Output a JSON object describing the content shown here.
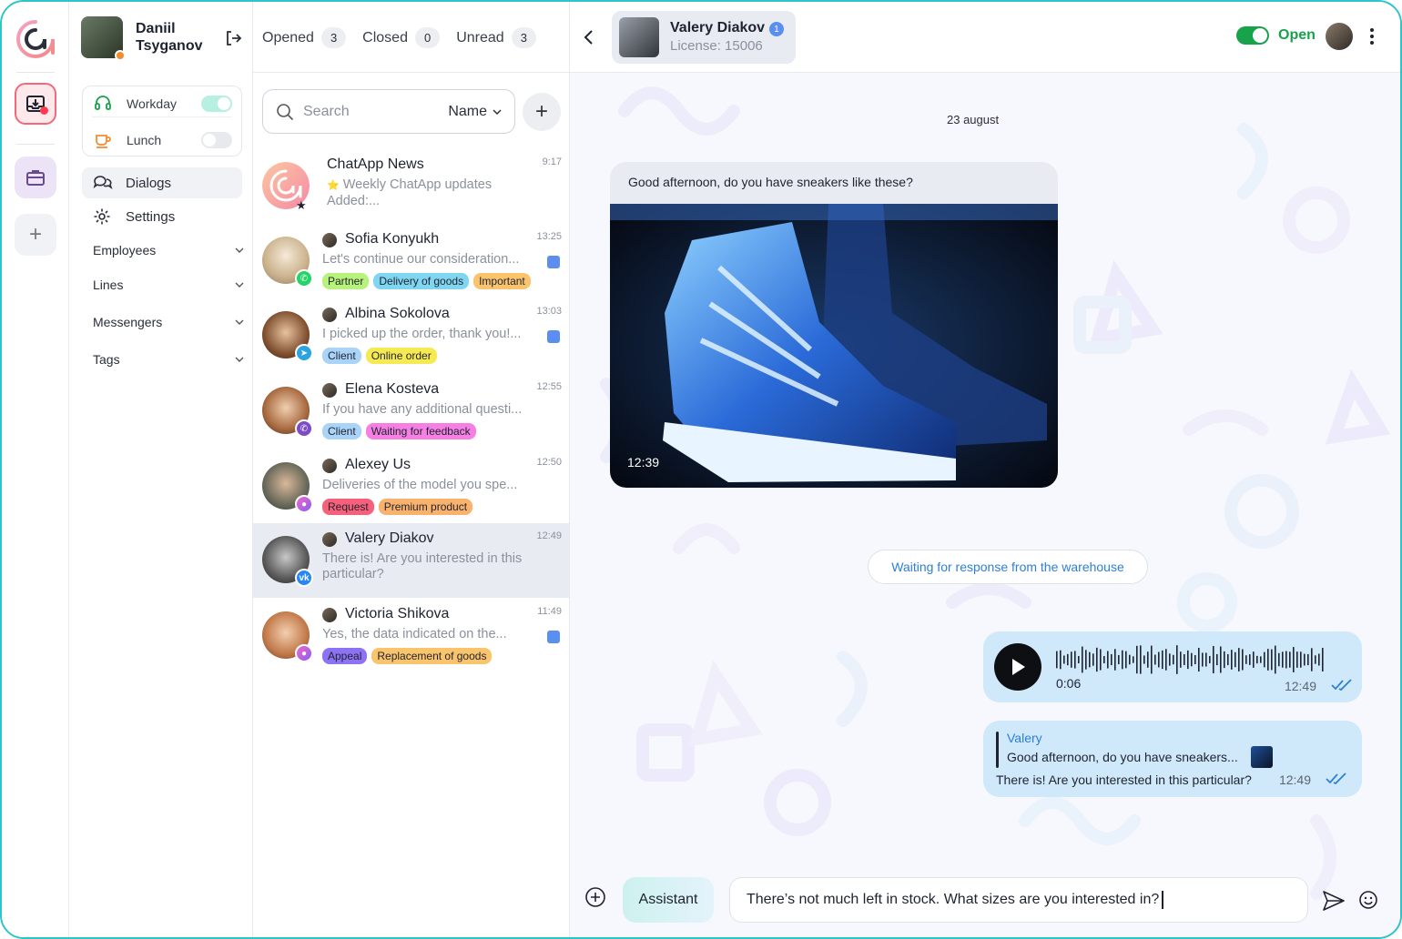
{
  "user": {
    "name": "Daniil Tsyganov"
  },
  "status": {
    "workday_label": "Workday",
    "lunch_label": "Lunch"
  },
  "nav": {
    "dialogs": "Dialogs",
    "settings": "Settings",
    "employees": "Employees",
    "lines": "Lines",
    "messengers": "Messengers",
    "tags": "Tags"
  },
  "tabs": [
    {
      "label": "Opened",
      "count": "3"
    },
    {
      "label": "Closed",
      "count": "0"
    },
    {
      "label": "Unread",
      "count": "3"
    }
  ],
  "search": {
    "placeholder": "Search",
    "sort": "Name"
  },
  "dialogs": [
    {
      "name": "ChatApp News",
      "time": "9:17",
      "preview": "Weekly ChatApp updates Added:...",
      "preview_icon": "⭐"
    },
    {
      "name": "Sofia Konyukh",
      "time": "13:25",
      "preview": "Let's continue our consideration...",
      "tags": [
        "Partner",
        "Delivery of goods",
        "Important"
      ]
    },
    {
      "name": "Albina Sokolova",
      "time": "13:03",
      "preview": "I picked up the order, thank you!...",
      "tags": [
        "Client",
        "Online order"
      ]
    },
    {
      "name": "Elena Kosteva",
      "time": "12:55",
      "preview": "If you have any additional questi...",
      "tags": [
        "Client",
        "Waiting for feedback"
      ]
    },
    {
      "name": "Alexey Us",
      "time": "12:50",
      "preview": "Deliveries of the model you spe...",
      "tags": [
        "Request",
        "Premium product"
      ]
    },
    {
      "name": "Valery Diakov",
      "time": "12:49",
      "preview": "There is! Are you interested in this  particular?"
    },
    {
      "name": "Victoria Shikova",
      "time": "11:49",
      "preview": "Yes, the data indicated on the...",
      "tags": [
        "Appeal",
        "Replacement of goods"
      ]
    }
  ],
  "tag_colors": {
    "Partner": "#b7f27a",
    "Delivery of goods": "#7fd6f0",
    "Important": "#f9c46b",
    "Client": "#a9d4f8",
    "Online order": "#f6ea52",
    "Waiting for feedback": "#f57fe3",
    "Request": "#f7607a",
    "Premium product": "#f9b26b",
    "Appeal": "#8d73f3",
    "Replacement of goods": "#f9c46b"
  },
  "chat": {
    "contact_name": "Valery Diakov",
    "contact_badge": "1",
    "license": "License: 15006",
    "status": "Open",
    "date": "23 august",
    "incoming_text": "Good afternoon, do you have sneakers like these?",
    "incoming_time": "12:39",
    "status_chip": "Waiting for response from the warehouse",
    "voice_duration": "0:06",
    "voice_time": "12:49",
    "reply_author": "Valery",
    "reply_quote": "Good afternoon, do you have sneakers...",
    "reply_text": "There is! Are you interested in this particular?",
    "reply_time": "12:49"
  },
  "composer": {
    "assistant_label": "Assistant",
    "input_value": "There’s not much left in stock. What sizes are you interested in?"
  },
  "colors": {
    "accent": "#2ec4c9",
    "open_green": "#17a34a",
    "bubble_out": "#cfe9fb",
    "link": "#2d7fd4"
  }
}
